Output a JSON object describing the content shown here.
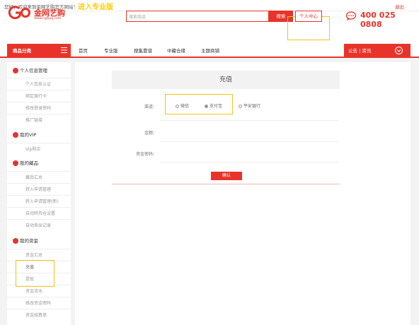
{
  "topbar": {
    "welcome": "您好，欢迎来到金网艺购官方网站！",
    "pro_link": "进入专业版",
    "logout": "退出"
  },
  "header": {
    "logo_text": "金网艺购",
    "logo_url": "www.rqjwyg.com",
    "search_placeholder": "搜索商品",
    "search_button": "搜索",
    "personal_center": "个人中心",
    "phone": "400 025 0808"
  },
  "nav": {
    "category": "商品分类",
    "items": [
      "首页",
      "专业版",
      "搜集靠谱",
      "中藏合缘",
      "主题商铺"
    ],
    "right": "公告 | 资讯"
  },
  "sidebar": {
    "sections": [
      {
        "title": "个人信息管理",
        "items": [
          "个人信息认证",
          "绑定银行卡",
          "修改登录密码",
          "推广链接"
        ]
      },
      {
        "title": "我的VIP",
        "items": [
          "Vip购买"
        ]
      },
      {
        "title": "我的藏品",
        "items": [
          "藏品汇总",
          "转入申请管理",
          "转入申请管理(新)",
          "自动转持仓设置",
          "自动卖出记录"
        ]
      },
      {
        "title": "我的资金",
        "items": [
          "资金汇总",
          "充值",
          "提现",
          "资金流水",
          "修改资金密码",
          "资金结算单"
        ]
      }
    ]
  },
  "main": {
    "title": "充值",
    "channel_label": "渠道：",
    "channels": [
      "微信",
      "支付宝",
      "平安银行"
    ],
    "selected_channel": "支付宝",
    "amount_label": "金额：",
    "password_label": "资金密码：",
    "confirm_button": "确认"
  },
  "colors": {
    "brand": "#e8332a",
    "highlight": "#f0c419"
  }
}
